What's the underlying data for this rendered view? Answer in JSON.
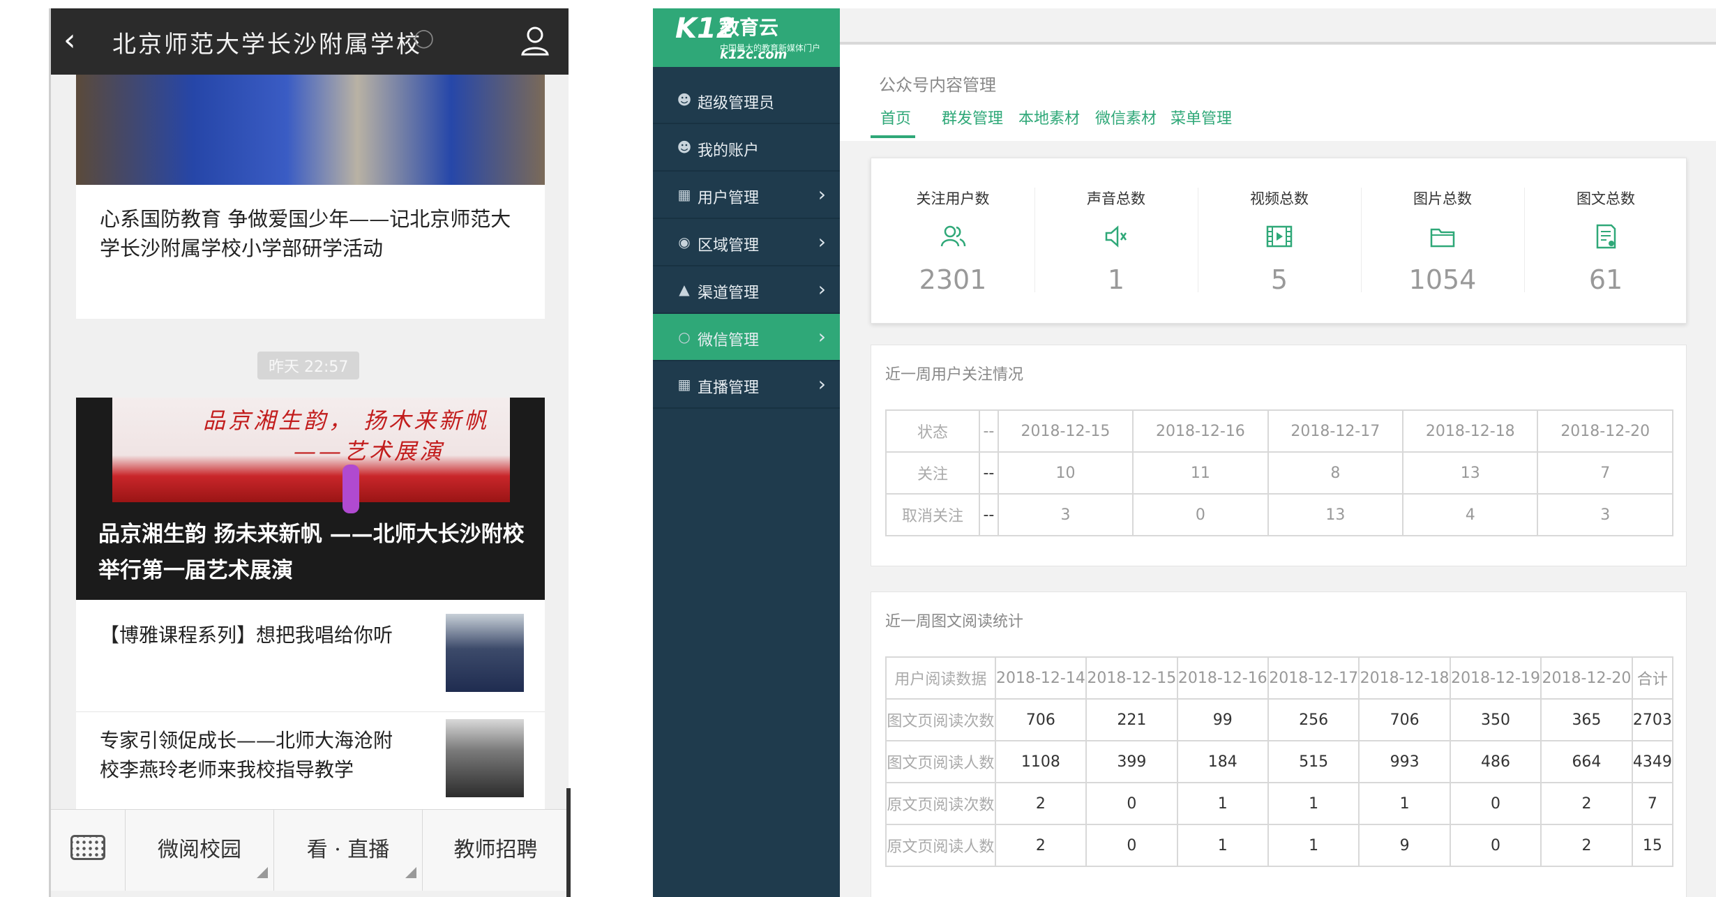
{
  "phone": {
    "title": "北京师范大学长沙附属学校",
    "back_icon": "chevron-left-icon",
    "profile_icon": "user-icon",
    "card1": {
      "title": "心系国防教育 争做爱国少年——记北京师范大学长沙附属学校小学部研学活动"
    },
    "timestamp": "昨天 22:57",
    "card2": {
      "banner_line1": "品京湘生韵， 扬木来新帆",
      "banner_line2": "——艺术展演",
      "caption": "品京湘生韵 扬未来新帆 ——北师大长沙附校举行第一届艺术展演",
      "items": [
        {
          "title": "【博雅课程系列】想把我唱给你听"
        },
        {
          "title": "专家引领促成长——北师大海沧附校李燕玲老师来我校指导教学"
        }
      ]
    },
    "menu": {
      "keyboard_icon": "keyboard-icon",
      "tabs": [
        "微阅校园",
        "看 · 直播",
        "教师招聘"
      ]
    }
  },
  "admin": {
    "logo": {
      "k12": "K12",
      "name": "教育云",
      "domain": "k12c.com",
      "slogan": "中国最大的教育新媒体门户"
    },
    "sidebar": [
      {
        "label": "超级管理员",
        "icon": "person-icon",
        "chevron": false
      },
      {
        "label": "我的账户",
        "icon": "person-icon",
        "chevron": false
      },
      {
        "label": "用户管理",
        "icon": "grid-icon",
        "chevron": true
      },
      {
        "label": "区域管理",
        "icon": "location-icon",
        "chevron": true
      },
      {
        "label": "渠道管理",
        "icon": "channel-icon",
        "chevron": true
      },
      {
        "label": "微信管理",
        "icon": "wechat-icon",
        "chevron": true,
        "active": true
      },
      {
        "label": "直播管理",
        "icon": "grid-icon",
        "chevron": true
      }
    ],
    "page_title": "公众号内容管理",
    "tabs": [
      "首页",
      "群发管理",
      "本地素材",
      "微信素材",
      "菜单管理"
    ],
    "stats": [
      {
        "label": "关注用户数",
        "value": "2301",
        "icon": "users-icon"
      },
      {
        "label": "声音总数",
        "value": "1",
        "icon": "speaker-icon"
      },
      {
        "label": "视频总数",
        "value": "5",
        "icon": "video-icon"
      },
      {
        "label": "图片总数",
        "value": "1054",
        "icon": "folder-icon"
      },
      {
        "label": "图文总数",
        "value": "61",
        "icon": "document-icon"
      }
    ],
    "follow_section": {
      "title": "近一周用户关注情况",
      "headers": [
        "状态",
        "--",
        "2018-12-15",
        "2018-12-16",
        "2018-12-17",
        "2018-12-18",
        "2018-12-20"
      ],
      "rows": [
        [
          "关注",
          "--",
          "10",
          "11",
          "8",
          "13",
          "7"
        ],
        [
          "取消关注",
          "--",
          "3",
          "0",
          "13",
          "4",
          "3"
        ]
      ]
    },
    "read_section": {
      "title": "近一周图文阅读统计",
      "headers": [
        "用户阅读数据",
        "2018-12-14",
        "2018-12-15",
        "2018-12-16",
        "2018-12-17",
        "2018-12-18",
        "2018-12-19",
        "2018-12-20",
        "合计"
      ],
      "rows": [
        [
          "图文页阅读次数",
          "706",
          "221",
          "99",
          "256",
          "706",
          "350",
          "365",
          "2703"
        ],
        [
          "图文页阅读人数",
          "1108",
          "399",
          "184",
          "515",
          "993",
          "486",
          "664",
          "4349"
        ],
        [
          "原文页阅读次数",
          "2",
          "0",
          "1",
          "1",
          "1",
          "0",
          "2",
          "7"
        ],
        [
          "原文页阅读人数",
          "2",
          "0",
          "1",
          "1",
          "9",
          "0",
          "2",
          "15"
        ]
      ]
    },
    "colors": {
      "accent": "#2fa878",
      "sidebar": "#1f3b4d"
    }
  }
}
